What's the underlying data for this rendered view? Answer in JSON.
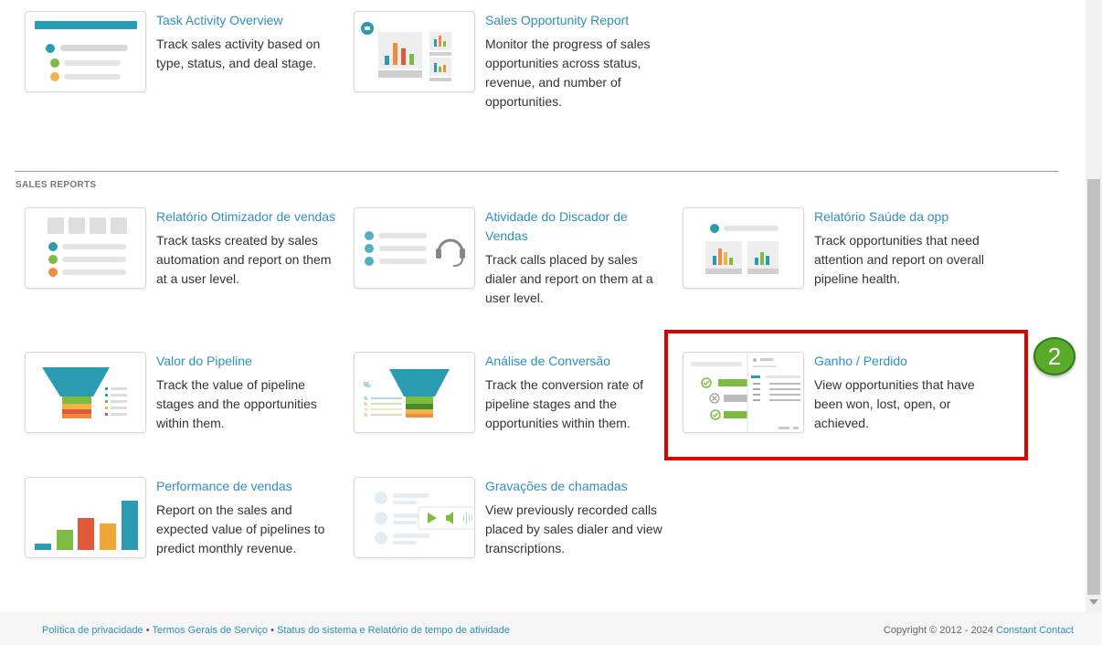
{
  "section": {
    "label": "SALES REPORTS"
  },
  "reports": [
    {
      "title": "Task Activity Overview",
      "desc": "Track sales activity based on type, status, and deal stage.",
      "thumb_icon": "task-list-icon"
    },
    {
      "title": "Sales Opportunity Report",
      "desc": "Monitor the progress of sales opportunities across status, revenue, and number of opportunities.",
      "thumb_icon": "bar-chart-icon"
    },
    {
      "title": "Relatório Otimizador de vendas",
      "desc": "Track tasks created by sales automation and report on them at a user level.",
      "thumb_icon": "user-list-icon"
    },
    {
      "title": "Atividade do Discador de Vendas",
      "desc": "Track calls placed by sales dialer and report on them at a user level.",
      "thumb_icon": "headset-icon"
    },
    {
      "title": "Relatório Saúde da opp",
      "desc": "Track opportunities that need attention and report on overall pipeline health.",
      "thumb_icon": "health-chart-icon"
    },
    {
      "title": "Valor do Pipeline",
      "desc": "Track the value of pipeline stages and the opportunities within them.",
      "thumb_icon": "funnel-icon"
    },
    {
      "title": "Análise de Conversão",
      "desc": "Track the conversion rate of pipeline stages and the opportunities within them.",
      "thumb_icon": "conversion-funnel-icon"
    },
    {
      "title": "Ganho / Perdido",
      "desc": "View opportunities that have been won, lost, open, or achieved.",
      "thumb_icon": "won-lost-icon"
    },
    {
      "title": "Performance de vendas",
      "desc": "Report on the sales and expected value of pipelines to predict monthly revenue.",
      "thumb_icon": "performance-bars-icon"
    },
    {
      "title": "Gravações de chamadas",
      "desc": "View previously recorded calls placed by sales dialer and view transcriptions.",
      "thumb_icon": "call-recording-icon"
    }
  ],
  "step_badge": "2",
  "footer": {
    "privacy": "Política de privacidade",
    "terms": "Termos Gerais de Serviço",
    "status": "Status do sistema e Relatório de tempo de atividade",
    "copyright": "Copyright © 2012 - 2024",
    "brand": "Constant Contact",
    "separator": "•"
  },
  "colors": {
    "link": "#2f8fbf",
    "highlight": "#e00000",
    "badge": "#5aaa2a",
    "teal": "#2a9bb0",
    "green": "#7dbb42",
    "orange": "#f08a3c",
    "red": "#e05a3a",
    "yellow": "#f2b44a"
  }
}
